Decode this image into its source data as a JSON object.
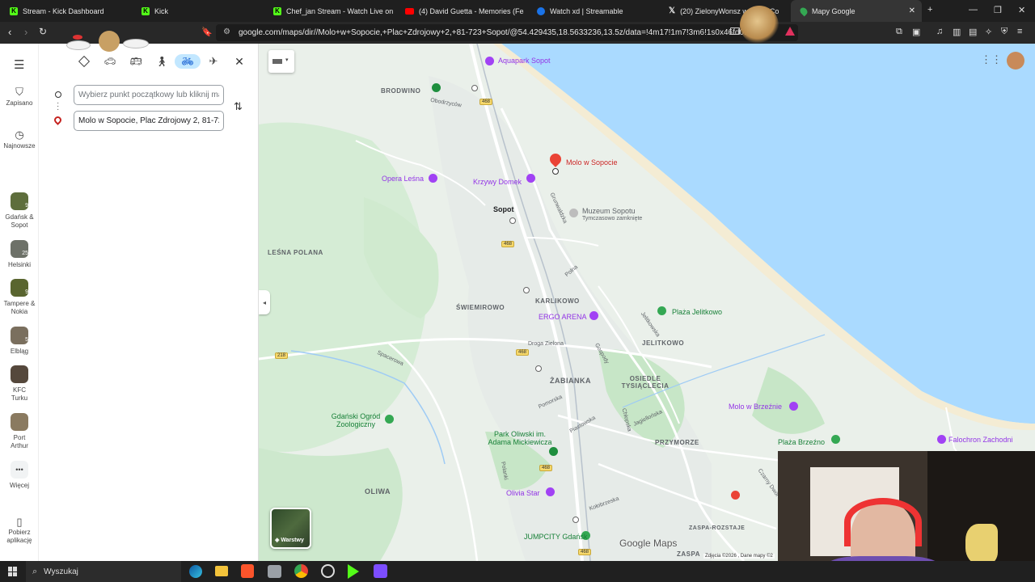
{
  "browser": {
    "tabs": [
      {
        "label": "Stream - Kick Dashboard",
        "icon": "kick-icon"
      },
      {
        "label": "Kick",
        "icon": "kick-icon"
      },
      {
        "label": "Chef_jan Stream - Watch Live on Kick",
        "icon": "kick-icon"
      },
      {
        "label": "(4) David Guetta - Memories (Featur",
        "icon": "youtube-icon"
      },
      {
        "label": "Watch xd | Streamable",
        "icon": "streamable-icon"
      },
      {
        "label": "(20) ZielonyWonsz w sen... Co",
        "icon": "x-icon"
      },
      {
        "label": "Mapy Google",
        "icon": "google-maps-icon"
      }
    ],
    "url": "google.com/maps/dir//Molo+w+Sopocie,+Plac+Zdrojowy+2,+81-723+Sopot/@54.429435,18.5633236,13.5z/data=!4m17!1m7!3m6!1s0x46fd0..."
  },
  "rail": {
    "menu_icon": "hamburger-icon",
    "items": [
      {
        "label": "Zapisano",
        "icon": "bookmark-icon"
      },
      {
        "label": "Najnowsze",
        "icon": "history-icon"
      },
      {
        "label": "Gdańsk & Sopot",
        "badge": "9"
      },
      {
        "label": "Helsinki",
        "badge": "25"
      },
      {
        "label": "Tampere & Nokia",
        "badge": "9"
      },
      {
        "label": "Elbląg",
        "badge": "5"
      },
      {
        "label": "KFC Turku",
        "badge": ""
      },
      {
        "label": "Port Arthur",
        "badge": ""
      },
      {
        "label": "Więcej",
        "icon": "more-icon"
      },
      {
        "label": "Pobierz aplikację",
        "icon": "phone-icon"
      }
    ]
  },
  "directions": {
    "origin_placeholder": "Wybierz punkt początkowy lub kliknij mapę",
    "destination_value": "Molo w Sopocie, Plac Zdrojowy 2, 81-723 Sopot"
  },
  "map": {
    "places": [
      {
        "text": "Aquapark Sopot",
        "kind": "poi"
      },
      {
        "text": "BRODWINO",
        "kind": "area"
      },
      {
        "text": "Obodrzyców",
        "kind": "road"
      },
      {
        "text": "Molo w Sopocie",
        "kind": "pin"
      },
      {
        "text": "Opera Leśna",
        "kind": "poi"
      },
      {
        "text": "Krzywy Domek",
        "kind": "poi"
      },
      {
        "text": "Sopot",
        "kind": "city"
      },
      {
        "text": "Muzeum Sopotu",
        "kind": "museum"
      },
      {
        "text": "Tymczasowo zamknięte",
        "kind": "sub"
      },
      {
        "text": "Grunwaldzka",
        "kind": "road"
      },
      {
        "text": "LEŚNA POLANA",
        "kind": "area"
      },
      {
        "text": "Polna",
        "kind": "road"
      },
      {
        "text": "KARLIKOWO",
        "kind": "area"
      },
      {
        "text": "ŚWIEMIROWO",
        "kind": "area"
      },
      {
        "text": "ERGO ARENA",
        "kind": "poi"
      },
      {
        "text": "Plaża Jelitkowo",
        "kind": "park"
      },
      {
        "text": "Jelitkowska",
        "kind": "road"
      },
      {
        "text": "Droga Zielona",
        "kind": "road"
      },
      {
        "text": "JELITKOWO",
        "kind": "area"
      },
      {
        "text": "Gospody",
        "kind": "road"
      },
      {
        "text": "Spacerowa",
        "kind": "road"
      },
      {
        "text": "ŻABIANKA",
        "kind": "area"
      },
      {
        "text": "OSIEDLE TYSIĄCLECIA",
        "kind": "area"
      },
      {
        "text": "Molo w Brzeźnie",
        "kind": "poi"
      },
      {
        "text": "Pomorska",
        "kind": "road"
      },
      {
        "text": "Gdański Ogród Zoologiczny",
        "kind": "park"
      },
      {
        "text": "Piastowska",
        "kind": "road"
      },
      {
        "text": "Chłopska",
        "kind": "road"
      },
      {
        "text": "Jagiellońska",
        "kind": "road"
      },
      {
        "text": "Park Oliwski im. Adama Mickiewicza",
        "kind": "park"
      },
      {
        "text": "PRZYMORZE",
        "kind": "area"
      },
      {
        "text": "Plaża Brzeźno",
        "kind": "park"
      },
      {
        "text": "Falochron Zachodni",
        "kind": "poi"
      },
      {
        "text": "Polanki",
        "kind": "road"
      },
      {
        "text": "OLIWA",
        "kind": "area"
      },
      {
        "text": "Olivia Star",
        "kind": "poi"
      },
      {
        "text": "Kołobrzeska",
        "kind": "road"
      },
      {
        "text": "Czarny Dwór",
        "kind": "road"
      },
      {
        "text": "ZASPA-ROZSTAJE",
        "kind": "area"
      },
      {
        "text": "JUMPCITY Gdańsk",
        "kind": "park"
      },
      {
        "text": "ZASPA",
        "kind": "area"
      }
    ],
    "shields": [
      "468",
      "468",
      "468",
      "468",
      "468",
      "468",
      "218"
    ],
    "layers_label": "Warstwy",
    "logo": "Google Maps",
    "attribution": "Zdjęcia ©2026 , Dane mapy ©2"
  },
  "taskbar": {
    "search_placeholder": "Wyszukaj"
  }
}
